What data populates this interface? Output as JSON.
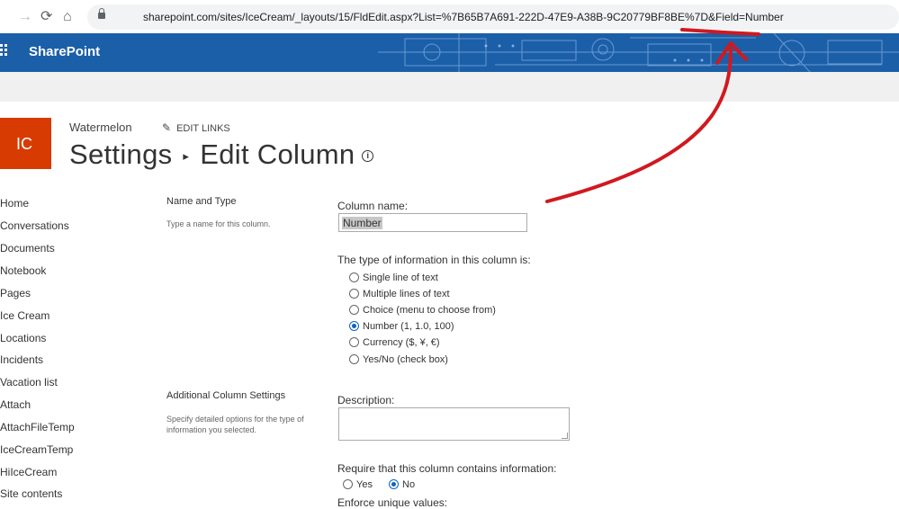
{
  "browser": {
    "url": "sharepoint.com/sites/IceCream/_layouts/15/FldEdit.aspx?List=%7B65B7A691-222D-47E9-A38B-9C20779BF8BE%7D&Field=Number"
  },
  "suite": {
    "brand": "SharePoint"
  },
  "site": {
    "logo_initials": "IC",
    "name": "Watermelon",
    "edit_links": "EDIT LINKS"
  },
  "page": {
    "crumb1": "Settings",
    "separator": "▸",
    "crumb2": "Edit Column",
    "info_icon": "i"
  },
  "leftnav": {
    "items": [
      "Home",
      "Conversations",
      "Documents",
      "Notebook",
      "Pages",
      "Ice Cream",
      "Locations",
      "Incidents",
      "Vacation list",
      "Attach",
      "AttachFileTemp",
      "IceCreamTemp",
      "HiIceCream",
      "Site contents"
    ]
  },
  "name_type": {
    "title": "Name and Type",
    "desc": "Type a name for this column.",
    "column_name_label": "Column name:",
    "column_name_value": "Number",
    "type_label": "The type of information in this column is:",
    "types": [
      {
        "label": "Single line of text",
        "checked": false
      },
      {
        "label": "Multiple lines of text",
        "checked": false
      },
      {
        "label": "Choice (menu to choose from)",
        "checked": false
      },
      {
        "label": "Number (1, 1.0, 100)",
        "checked": true
      },
      {
        "label": "Currency ($, ¥, €)",
        "checked": false
      },
      {
        "label": "Yes/No (check box)",
        "checked": false
      }
    ]
  },
  "additional": {
    "title": "Additional Column Settings",
    "desc": "Specify detailed options for the type of information you selected.",
    "description_label": "Description:",
    "description_value": "",
    "require_label": "Require that this column contains information:",
    "require_yes": "Yes",
    "require_no": "No",
    "require_selected": "No",
    "unique_label": "Enforce unique values:"
  },
  "colors": {
    "suite_bar": "#1b5fa8",
    "site_logo": "#d83b01",
    "annotation": "#d0191f",
    "radio_checked": "#0b63c9"
  }
}
